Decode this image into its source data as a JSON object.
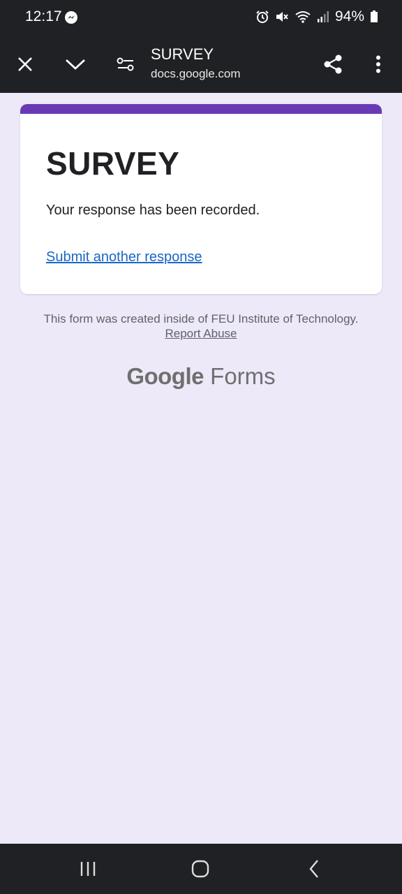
{
  "status_bar": {
    "time": "12:17",
    "battery": "94%"
  },
  "toolbar": {
    "title": "SURVEY",
    "url": "docs.google.com"
  },
  "form": {
    "title": "SURVEY",
    "message": "Your response has been recorded.",
    "link": "Submit another response",
    "accent_color": "#6a3ab5"
  },
  "footer": {
    "text": "This form was created inside of FEU Institute of Technology.",
    "report_link": "Report Abuse",
    "brand_google": "Google",
    "brand_forms": "Forms"
  },
  "icons": {
    "status": [
      "messenger-icon",
      "alarm-icon",
      "mute-icon",
      "wifi-icon",
      "signal-icon",
      "battery-icon"
    ],
    "toolbar": [
      "close-icon",
      "chevron-down-icon",
      "page-settings-icon",
      "share-icon",
      "more-vert-icon"
    ],
    "nav": [
      "recents-icon",
      "home-icon",
      "back-icon"
    ]
  }
}
